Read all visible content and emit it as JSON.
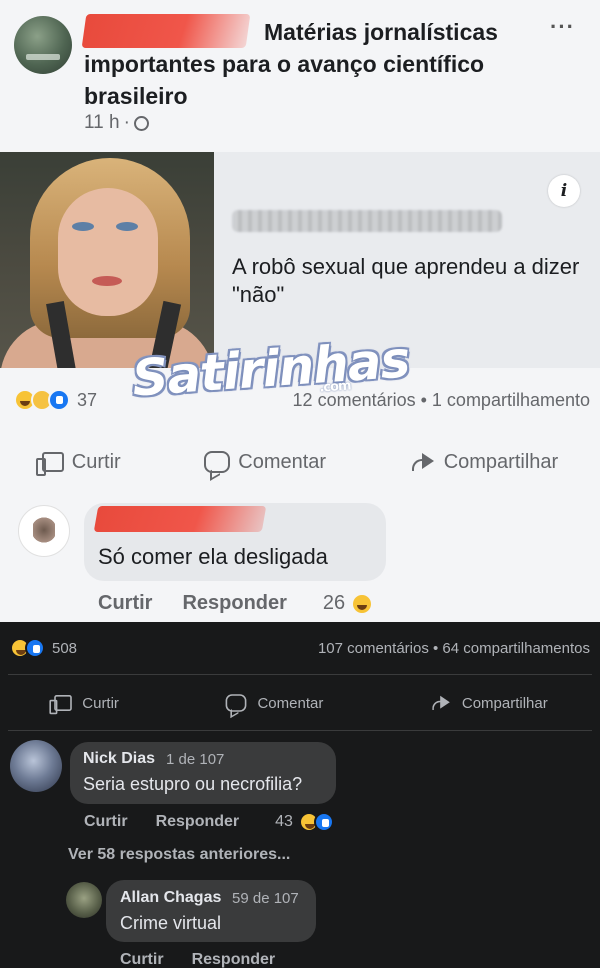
{
  "post": {
    "title": "Matérias jornalísticas importantes para o avanço científico brasileiro",
    "time": "11 h",
    "more": "···"
  },
  "link": {
    "info_icon": "i",
    "title": "A robô sexual que aprendeu a dizer \"não\""
  },
  "watermark": {
    "text": "Satirinhas",
    "suffix": ".com"
  },
  "stats1": {
    "reaction_count": "37",
    "right": "12 comentários • 1 compartilhamento"
  },
  "actions1": {
    "like": "Curtir",
    "comment": "Comentar",
    "share": "Compartilhar"
  },
  "comment1": {
    "text": "Só comer ela desligada",
    "like": "Curtir",
    "reply": "Responder",
    "reaction_count": "26"
  },
  "stats2": {
    "reaction_count": "508",
    "right": "107 comentários • 64 compartilhamentos"
  },
  "actions2": {
    "like": "Curtir",
    "comment": "Comentar",
    "share": "Compartilhar"
  },
  "comment2": {
    "name": "Nick Dias",
    "meta": "1 de 107",
    "text": "Seria estupro ou necrofilia?",
    "like": "Curtir",
    "reply": "Responder",
    "reaction_count": "43"
  },
  "see_previous": "Ver 58 respostas anteriores...",
  "comment3": {
    "name": "Allan Chagas",
    "meta": "59 de 107",
    "text": "Crime virtual",
    "like": "Curtir",
    "reply": "Responder"
  },
  "colors": {
    "redaction": "#f0564a",
    "like_blue": "#1877f2",
    "haha_yellow": "#f7c336",
    "dark_bg": "#18191a"
  }
}
